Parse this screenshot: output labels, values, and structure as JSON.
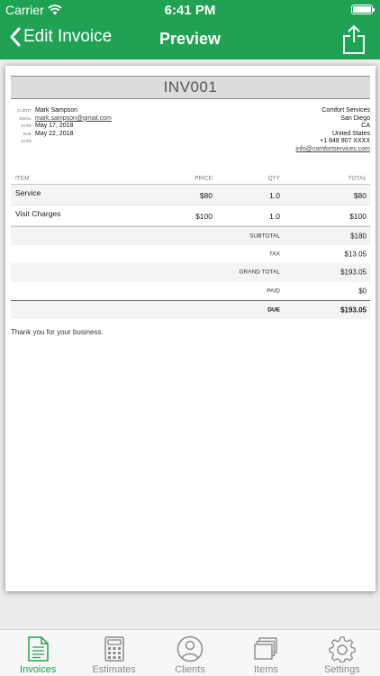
{
  "status_bar": {
    "carrier": "Carrier",
    "time": "6:41 PM",
    "battery_level": 1.0
  },
  "nav": {
    "back_label": "Edit Invoice",
    "title": "Preview"
  },
  "invoice": {
    "number": "INV001",
    "client": [
      {
        "key": "CLIENT",
        "value": "Mark Sampson",
        "link": false
      },
      {
        "key": "EMAIL",
        "value": "mark.sampson@gmail.com",
        "link": true
      },
      {
        "key": "DATE",
        "value": "May 17, 2018",
        "link": false
      },
      {
        "key": "DUE DATE",
        "value": "May 22, 2018",
        "link": false
      }
    ],
    "company": {
      "name": "Comfort Services",
      "city": "San Diego",
      "state": "CA",
      "country": "United States",
      "phone": "+1 848 907 XXXX",
      "email": "info@comfortservices.com"
    },
    "columns": {
      "item": "ITEM",
      "price": "PRICE",
      "qty": "QTY",
      "total": "TOTAL"
    },
    "items": [
      {
        "name": "Service",
        "price": "$80",
        "qty": "1.0",
        "total": "$80"
      },
      {
        "name": "Visit Charges",
        "price": "$100",
        "qty": "1.0",
        "total": "$100"
      }
    ],
    "summary": {
      "subtotal_label": "SUBTOTAL",
      "subtotal": "$180",
      "tax_label": "TAX",
      "tax": "$13.05",
      "grand_total_label": "GRAND TOTAL",
      "grand_total": "$193.05",
      "paid_label": "PAID",
      "paid": "$0",
      "due_label": "DUE",
      "due": "$193.05"
    },
    "thanks": "Thank you for your business."
  },
  "tabs": [
    {
      "label": "Invoices",
      "icon": "invoice-document-icon",
      "active": true
    },
    {
      "label": "Estimates",
      "icon": "calculator-icon",
      "active": false
    },
    {
      "label": "Clients",
      "icon": "person-icon",
      "active": false
    },
    {
      "label": "Items",
      "icon": "stacked-items-icon",
      "active": false
    },
    {
      "label": "Settings",
      "icon": "gear-icon",
      "active": false
    }
  ],
  "colors": {
    "brand_green": "#1fa254",
    "tab_inactive": "#8a8a8a"
  }
}
